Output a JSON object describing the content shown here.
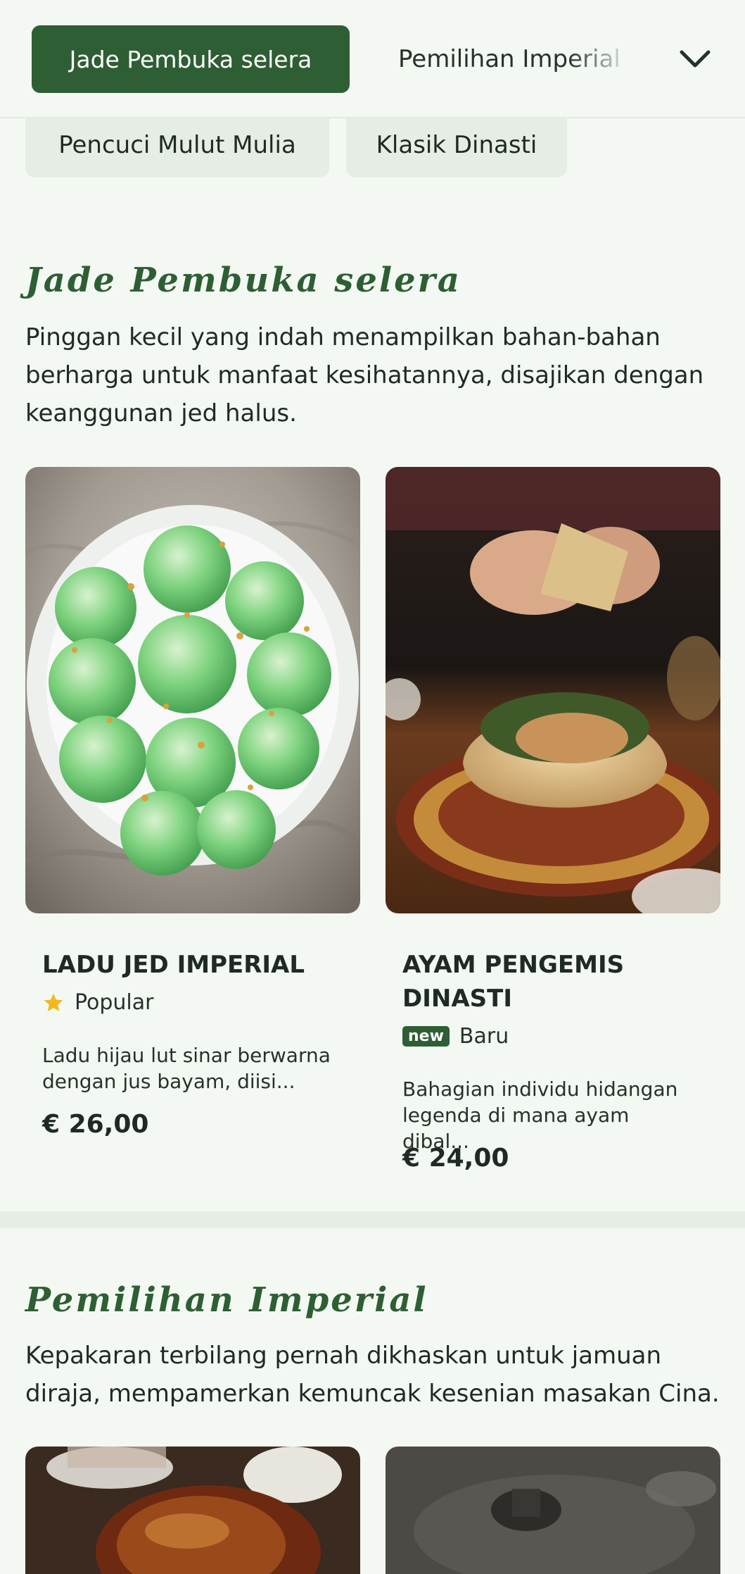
{
  "category_bar": {
    "active_chip": "Jade Pembuka selera",
    "next_chip": "Pemilihan Imperial",
    "sub_chips": [
      "Pencuci Mulut Mulia",
      "Klasik Dinasti"
    ]
  },
  "sections": [
    {
      "title": "Jade Pembuka selera",
      "description": "Pinggan kecil yang indah menampilkan bahan-bahan berharga untuk manfaat kesihatannya, disajikan dengan keanggunan jed halus.",
      "items": [
        {
          "name": "LADU JED IMPERIAL",
          "badge_label": "Popular",
          "badge_icon": "star-icon",
          "description": "Ladu hijau lut sinar berwarna dengan jus bayam, diisi...",
          "price": "€ 26,00"
        },
        {
          "name": "AYAM PENGEMIS DINASTI",
          "badge_tag": "new",
          "badge_label": "Baru",
          "description": "Bahagian individu hidangan legenda di mana ayam dibal...",
          "price": "€ 24,00"
        }
      ]
    },
    {
      "title": "Pemilihan Imperial",
      "description": "Kepakaran terbilang pernah dikhaskan untuk jamuan diraja, mempamerkan kemuncak kesenian masakan Cina."
    }
  ],
  "colors": {
    "brand_green": "#2e5e34",
    "background": "#f3f8f2",
    "star": "#f2b91f"
  }
}
